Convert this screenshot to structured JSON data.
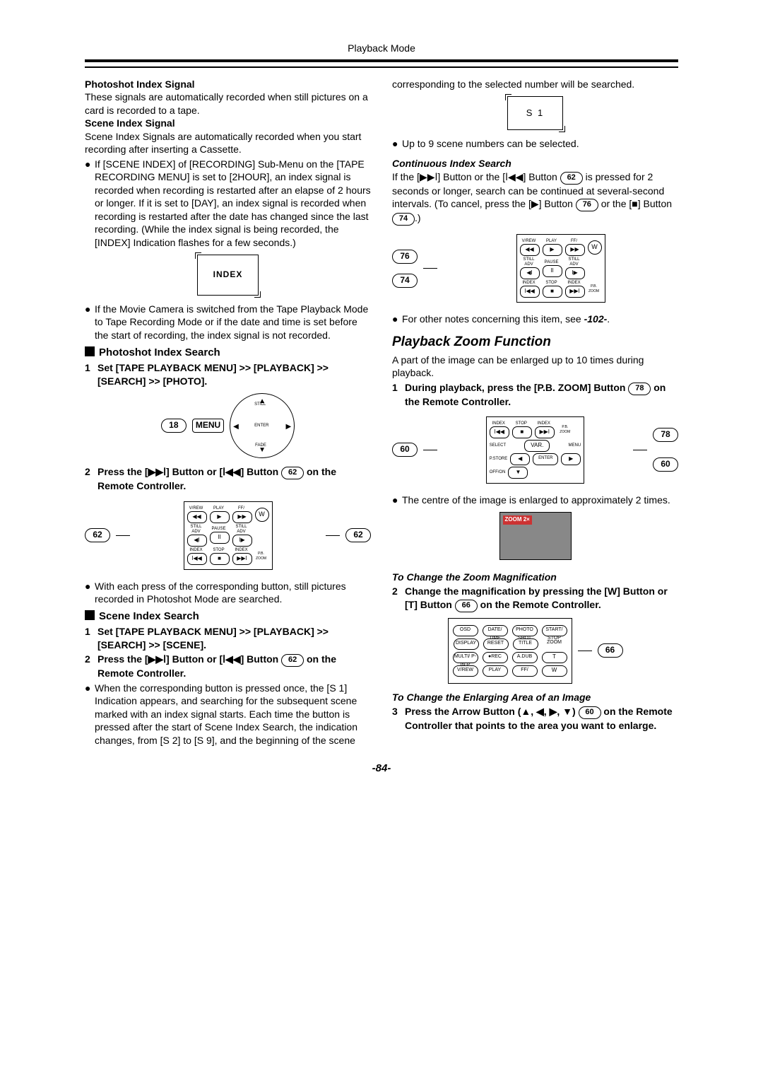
{
  "header": "Playback Mode",
  "page_number": "-84-",
  "left": {
    "photoshot_index_signal_h": "Photoshot Index Signal",
    "photoshot_index_signal_p": "These signals are automatically recorded when still pictures on a card is recorded to a tape.",
    "scene_index_signal_h": "Scene Index Signal",
    "scene_index_signal_p": "Scene Index Signals are automatically recorded when you start recording after inserting a Cassette.",
    "bullet1": "If [SCENE INDEX] of [RECORDING] Sub-Menu on the [TAPE RECORDING MENU] is set to [2HOUR], an index signal is recorded when recording is restarted after an elapse of 2 hours or longer. If it is set to [DAY], an index signal is recorded when recording is restarted after the date has changed since the last recording. (While the index signal is being recorded, the [INDEX] Indication flashes for a few seconds.)",
    "index_box": "INDEX",
    "bullet2": "If the Movie Camera is switched from the Tape Playback Mode to Tape Recording Mode or if the date and time is set before the start of recording, the index signal is not recorded.",
    "photoshot_search_h": "Photoshot Index Search",
    "step1": "Set [TAPE PLAYBACK MENU] >> [PLAYBACK] >> [SEARCH] >> [PHOTO].",
    "dial_ref": "18",
    "dial_menu": "MENU",
    "step2_a": "Press the [",
    "step2_b": "] Button or [",
    "step2_c": "] Button",
    "step2_ref": "62",
    "step2_d": "on the Remote Controller.",
    "remote_ref_l": "62",
    "remote_ref_r": "62",
    "bullet3": "With each press of the corresponding button, still pictures recorded in Photoshot Mode are searched.",
    "scene_search_h": "Scene Index Search",
    "scene_step1": "Set [TAPE PLAYBACK MENU] >> [PLAYBACK] >> [SEARCH] >> [SCENE].",
    "scene_step2_a": "Press the [",
    "scene_step2_b": "] Button or [",
    "scene_step2_c": "] Button",
    "scene_step2_ref": "62",
    "scene_step2_d": "on the Remote Controller.",
    "bullet4": "When the corresponding button is pressed once, the [S 1] Indication appears, and searching for the subsequent scene marked with an index signal starts. Each time the button is pressed after the start of Scene Index Search, the indication changes, from [S 2] to [S 9], and the beginning of the scene"
  },
  "right": {
    "cont_top": "corresponding to the selected number will be searched.",
    "s1_box": "S  1",
    "bullet_up9": "Up to 9 scene numbers can be selected.",
    "cont_search_h": "Continuous Index Search",
    "cont_p_a": "If the [",
    "cont_p_b": "] Button or the [",
    "cont_p_c": "] Button",
    "cont_ref1": "62",
    "cont_p_d": "is pressed for 2 seconds or longer, search can be continued at several-second intervals. (To cancel, press the [",
    "cont_p_e": "] Button",
    "cont_ref2": "76",
    "cont_p_f": "or the [",
    "cont_p_g": "] Button",
    "cont_ref3": "74",
    "cont_p_h": ".)",
    "fig2_ref_top": "76",
    "fig2_ref_bot": "74",
    "bullet_notes_a": "For other notes concerning this item, see ",
    "bullet_notes_ref": "-102-",
    "bullet_notes_b": ".",
    "zoom_h": "Playback Zoom Function",
    "zoom_p": "A part of the image can be enlarged up to 10 times during playback.",
    "zoom_step1_a": "During playback, press the [P.B. ZOOM] Button",
    "zoom_step1_ref": "78",
    "zoom_step1_b": "on the Remote Controller.",
    "fig3_ref_r": "78",
    "fig3_ref_l": "60",
    "fig3_ref_r2": "60",
    "bullet_centre": "The centre of the image is enlarged to approximately 2 times.",
    "zoom_thumb_label": "ZOOM 2×",
    "change_mag_h": "To Change the Zoom Magnification",
    "mag_step2_a": "Change the magnification by pressing the [W] Button or [T] Button",
    "mag_step2_ref": "66",
    "mag_step2_b": "on the Remote Controller.",
    "fig4_ref": "66",
    "enlarge_area_h": "To Change the Enlarging Area of an Image",
    "step3_a": "Press the Arrow Button (▲, ◀, ▶, ▼)",
    "step3_ref": "60",
    "step3_b": "on the Remote Controller that points to the area you want to enlarge."
  },
  "remote_labels": {
    "row1": [
      "V/REW",
      "PLAY",
      "FF/"
    ],
    "row1_btns": [
      "◀◀",
      "▶",
      "▶▶"
    ],
    "row2": [
      "STILL ADV",
      "PAUSE",
      "STILL ADV"
    ],
    "row2_btns": [
      "◀ⅼ",
      "ⅼⅼ",
      "ⅼ▶"
    ],
    "row3": [
      "INDEX",
      "STOP",
      "INDEX"
    ],
    "row3_btns": [
      "ⅼ◀◀",
      "■",
      "▶▶ⅼ"
    ],
    "pb_zoom": "P.B. ZOOM",
    "w": "W",
    "t": "T"
  },
  "ctrl_labels": {
    "osd": "OSD",
    "date": "DATE/\nTIME",
    "photo": "PHOTO\nSHOT",
    "start": "START/\nSTOP",
    "display": "DISPLAY",
    "reset": "RESET",
    "title": "TITLE",
    "zoom": "ZOOM",
    "multi": "MULTI/\nP-IN-P",
    "rec": "●REC",
    "adub": "A.DUB",
    "rew": "V/REW",
    "play": "PLAY",
    "ff": "FF/",
    "select": "SELECT",
    "var": "VAR.",
    "menu": "MENU",
    "enter": "ENTER",
    "store": "P.STORE",
    "off": "OFF/ON"
  }
}
